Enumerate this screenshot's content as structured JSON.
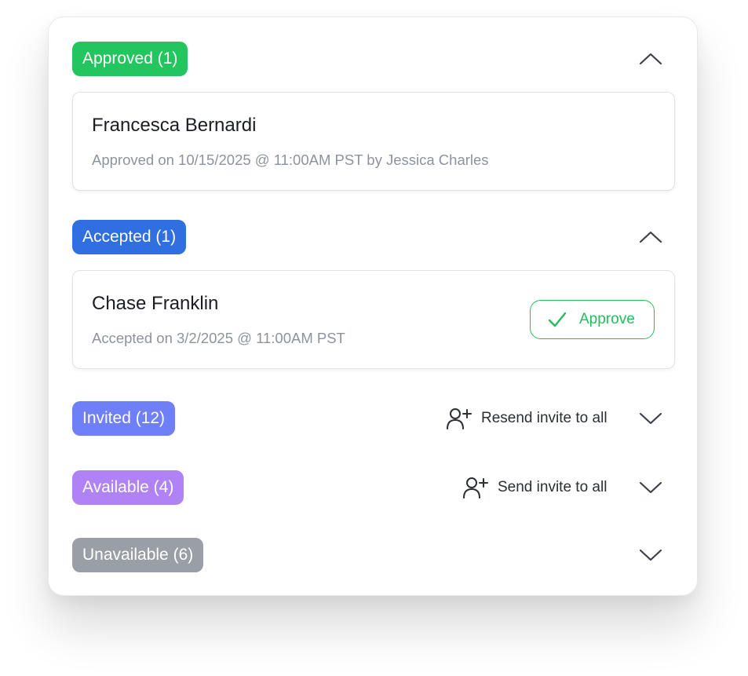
{
  "colors": {
    "approved": "#22c55e",
    "accepted": "#2f6fe0",
    "invited": "#6f7ff7",
    "available": "#b083f5",
    "unavailable": "#9a9ea6",
    "approve_button": "#1fbf5c"
  },
  "sections": {
    "approved": {
      "badge": "Approved (1)",
      "expanded": true,
      "entries": [
        {
          "name": "Francesca Bernardi",
          "status": "Approved on 10/15/2025 @ 11:00AM PST by Jessica Charles"
        }
      ]
    },
    "accepted": {
      "badge": "Accepted (1)",
      "expanded": true,
      "entries": [
        {
          "name": "Chase Franklin",
          "status": "Accepted on 3/2/2025 @ 11:00AM PST",
          "action_label": "Approve",
          "action_icon": "check-icon"
        }
      ]
    },
    "invited": {
      "badge": "Invited (12)",
      "expanded": false,
      "action_label": "Resend invite to all",
      "action_icon": "user-plus-icon"
    },
    "available": {
      "badge": "Available (4)",
      "expanded": false,
      "action_label": "Send invite to all",
      "action_icon": "user-plus-icon"
    },
    "unavailable": {
      "badge": "Unavailable (6)",
      "expanded": false
    }
  }
}
